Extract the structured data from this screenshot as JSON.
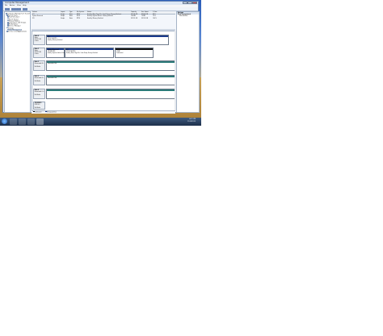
{
  "window": {
    "title": "Computer Management",
    "menus": [
      "File",
      "Action",
      "View",
      "Help"
    ]
  },
  "tree": {
    "items": [
      "Computer Management (Local)",
      "System Tools",
      "Task Scheduler",
      "Event Viewer",
      "Shared Folders",
      "Local Users and Groups",
      "Performance",
      "Device Manager",
      "Storage",
      "Disk Management",
      "Services and Applications"
    ]
  },
  "volumes": {
    "headers": [
      "Volume",
      "Layout",
      "Type",
      "File System",
      "Status",
      "Capacity",
      "Free Space",
      "% Free"
    ],
    "rows": [
      [
        "(C:)",
        "Simple",
        "Basic",
        "NTFS",
        "Healthy (Boot, Page File, Crash Dump, Primary Partition)",
        "931.39 GB",
        "830.66 GB",
        "89 %"
      ],
      [
        "System Reserved",
        "Simple",
        "Basic",
        "NTFS",
        "Healthy (System, Active, Primary Partition)",
        "100 MB",
        "70 MB",
        "70 %"
      ],
      [
        "(D:)",
        "Simple",
        "Basic",
        "NTFS",
        "Healthy (Primary Partition)",
        "931.51 GB",
        "931.32 GB",
        "100 %"
      ]
    ]
  },
  "disks": [
    {
      "label": "Disk 0",
      "lines": [
        "Basic",
        "931.51 GB",
        "Online"
      ],
      "volumes": [
        {
          "title": "(D:)",
          "lines": [
            "931.51 GB NTFS",
            "Healthy (Primary Partition)"
          ],
          "color": "#1a3a8c"
        }
      ]
    },
    {
      "label": "Disk 1",
      "lines": [
        "Basic",
        "931.51 GB",
        "Online"
      ],
      "volumes": [
        {
          "title": "System Reserved",
          "lines": [
            "100 MB NTFS",
            "Healthy (System, Active, Primary Partition)"
          ],
          "color": "#1a3a8c"
        },
        {
          "title": "(C:)",
          "lines": [
            "931.39 GB NTFS",
            "Healthy (Boot, Page File, Crash Dump, Primary Partition)"
          ],
          "color": "#1a3a8c"
        },
        {
          "title": "",
          "lines": [
            "23 MB",
            "Unallocated"
          ],
          "color": "#111111"
        }
      ]
    },
    {
      "label": "Disk 2",
      "lines": [
        "Removable (E:)",
        "",
        "No Media"
      ],
      "volumes": [
        {
          "title": "",
          "lines": [
            "Removable Disk",
            ""
          ],
          "color": "#2b7a78"
        }
      ]
    },
    {
      "label": "Disk 3",
      "lines": [
        "Removable (F:)",
        "",
        "No Media"
      ],
      "volumes": [
        {
          "title": "",
          "lines": [
            "Removable Disk",
            ""
          ],
          "color": "#2b7a78"
        }
      ]
    },
    {
      "label": "Disk 4",
      "lines": [
        "Removable (G:)",
        "",
        "No Media"
      ],
      "volumes": [
        {
          "title": "",
          "lines": [
            "",
            ""
          ],
          "color": "#2b7a78"
        }
      ]
    },
    {
      "label": "CD-ROM 0",
      "lines": [
        "DVD (H:)",
        "",
        "No Media"
      ],
      "volumes": []
    }
  ],
  "legend": [
    "Unallocated",
    "Primary partition"
  ],
  "legend_colors": [
    "#111111",
    "#1a3a8c"
  ],
  "actions": {
    "header": "Actions",
    "items": [
      "Disk Management",
      "More Actions"
    ]
  },
  "clock": {
    "time": "4:21 PM",
    "date": "11/4/2012"
  }
}
